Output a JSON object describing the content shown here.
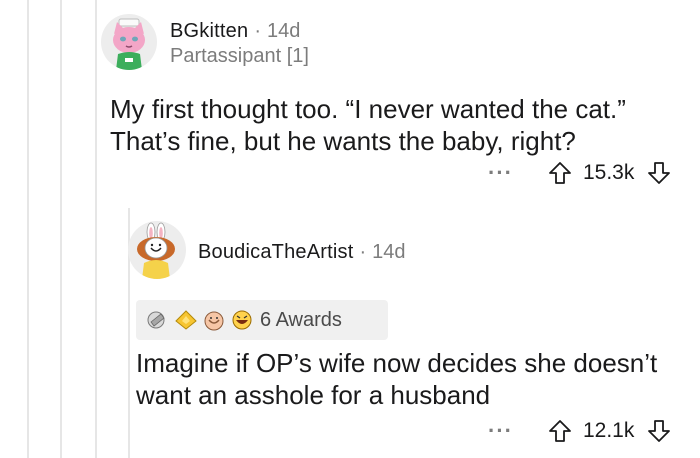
{
  "comments": [
    {
      "username": "BGkitten",
      "separator": "·",
      "age": "14d",
      "flair": "Partassipant [1]",
      "text_lines": [
        "My first thought too. “I never wanted the cat.”",
        "That’s fine, but he wants the baby, right?"
      ],
      "more_label": "···",
      "score": "15.3k",
      "avatar_icon": "pink-cat-avatar-icon"
    },
    {
      "username": "BoudicaTheArtist",
      "separator": "·",
      "age": "14d",
      "awards_label": "6 Awards",
      "award_icons": [
        "silver-award-icon",
        "gold-award-icon",
        "wholesome-award-icon",
        "laughing-award-icon"
      ],
      "text_lines": [
        "Imagine if OP’s wife now decides she doesn’t",
        "want an asshole for a husband"
      ],
      "more_label": "···",
      "score": "12.1k",
      "avatar_icon": "bunny-ears-avatar-icon"
    }
  ],
  "colors": {
    "text": "#1a1a1b",
    "meta": "#7c7c7c",
    "thread_line": "#e6e6e6",
    "awards_bg": "#f0f0f0"
  }
}
